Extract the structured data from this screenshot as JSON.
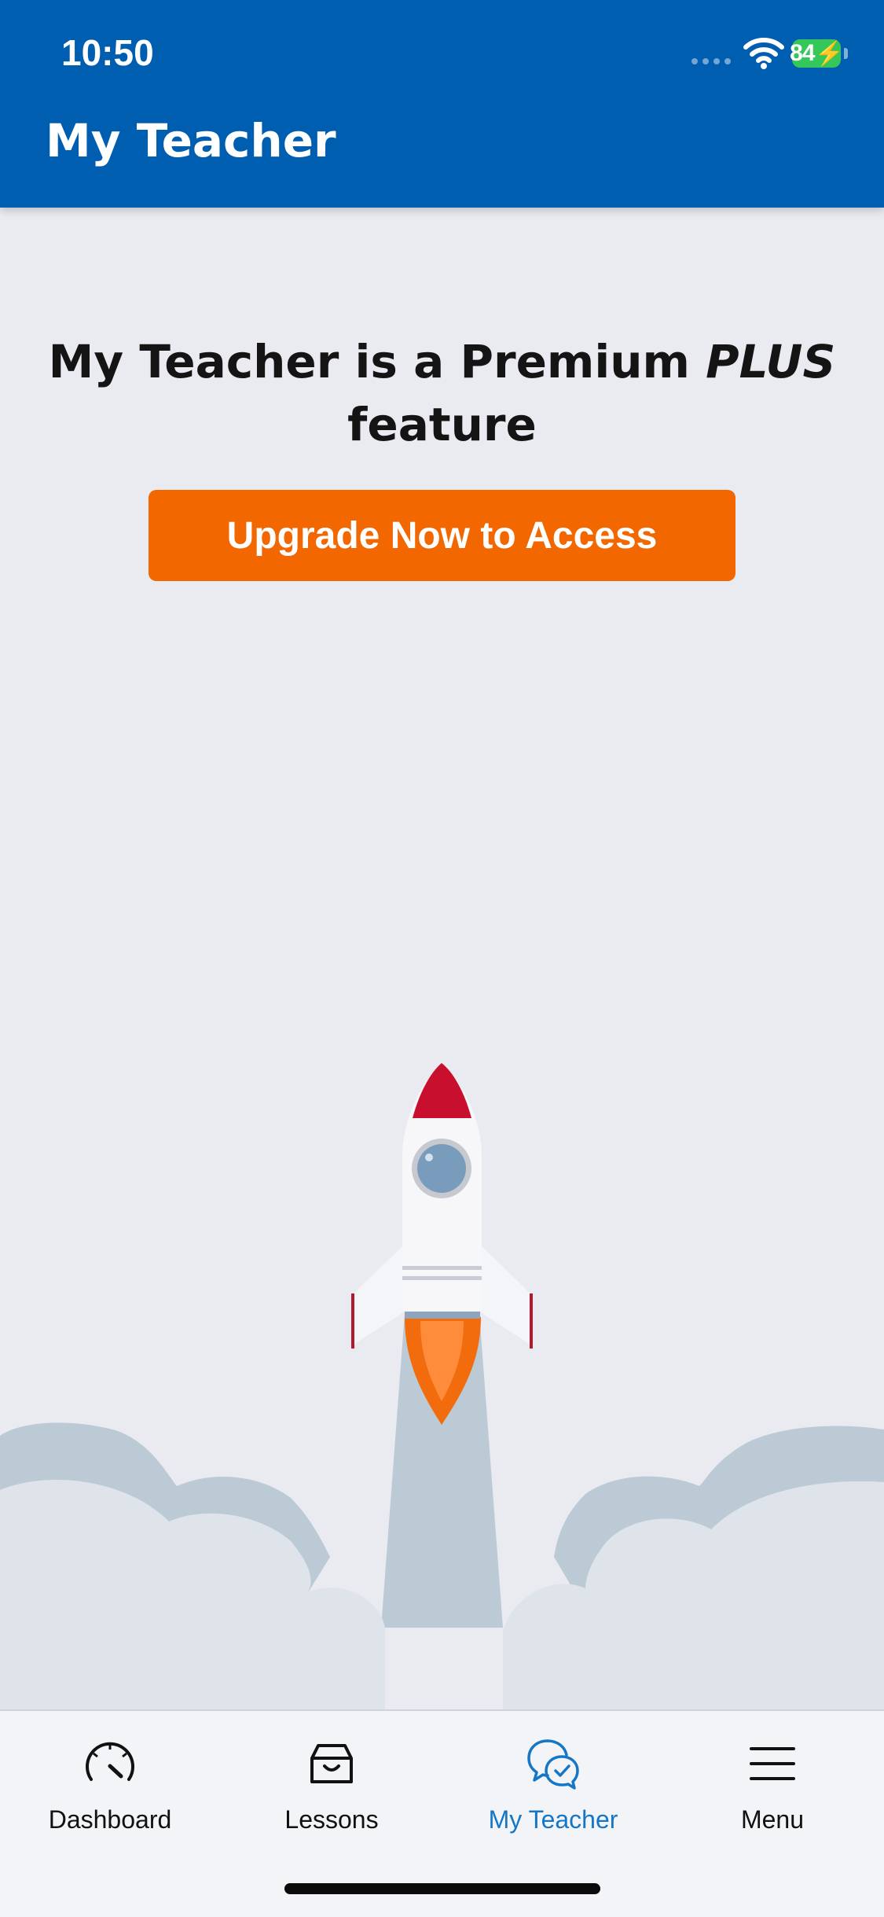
{
  "status_bar": {
    "time": "10:50",
    "battery": "84"
  },
  "header": {
    "title": "My Teacher"
  },
  "main": {
    "heading_prefix": "My Teacher is a Premium ",
    "heading_emphasis": "PLUS",
    "heading_suffix": " feature",
    "upgrade_button": "Upgrade Now to Access",
    "illustration": "rocket-launch"
  },
  "tab_bar": {
    "tabs": [
      {
        "label": "Dashboard",
        "icon": "speedometer-icon",
        "active": false
      },
      {
        "label": "Lessons",
        "icon": "inbox-tray-icon",
        "active": false
      },
      {
        "label": "My Teacher",
        "icon": "chat-bubbles-check-icon",
        "active": true
      },
      {
        "label": "Menu",
        "icon": "hamburger-menu-icon",
        "active": false
      }
    ]
  },
  "colors": {
    "header": "#005eb0",
    "accent_button": "#f26700",
    "active_tab": "#1676c6",
    "background": "#eaeaf1"
  }
}
